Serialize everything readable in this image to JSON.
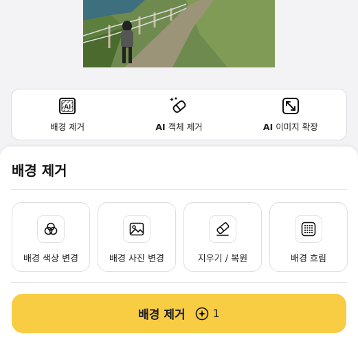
{
  "tools": [
    {
      "icon": "ai-remove-bg-icon",
      "label": "배경 제거"
    },
    {
      "icon": "eraser-icon",
      "prefix": "AI",
      "label": "객체 제거"
    },
    {
      "icon": "expand-icon",
      "prefix": "AI",
      "label": "이미지 확장"
    }
  ],
  "sheet": {
    "title": "배경 제거",
    "options": [
      {
        "icon": "color-circles-icon",
        "label": "배경 색상 변경"
      },
      {
        "icon": "image-icon",
        "label": "배경 사진 변경"
      },
      {
        "icon": "eraser-icon",
        "label": "지우기 / 복원"
      },
      {
        "icon": "blur-grid-icon",
        "label": "배경 흐림"
      }
    ],
    "cta": {
      "label": "배경 제거",
      "credit_icon": "sparkle-coin-icon",
      "credit": "1"
    }
  },
  "colors": {
    "accent": "#f8cd43",
    "background": "#f3f3f5"
  }
}
